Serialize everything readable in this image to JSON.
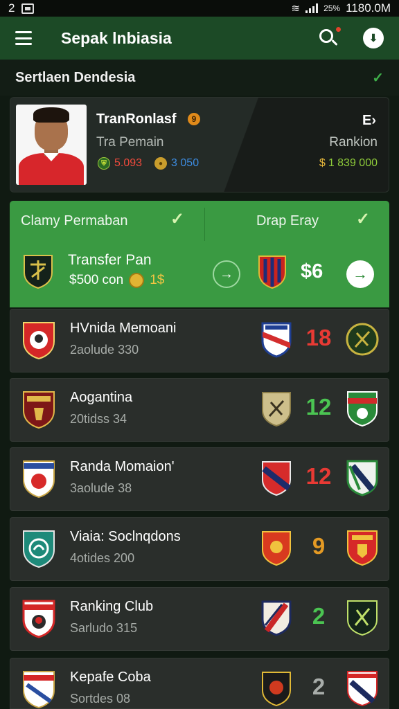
{
  "status_bar": {
    "left": "2",
    "battery_pct": "25%",
    "time": "1180.0M"
  },
  "app_bar": {
    "title": "Sepak lnbiasia"
  },
  "section": {
    "title": "Sertlaen Dendesia"
  },
  "profile_card": {
    "name": "TranRonlasf",
    "info_badge": "9",
    "subtitle": "Tra Pemain",
    "stat_a": "5.093",
    "stat_b": "3 050",
    "ranking_label": "Rankion",
    "ranking_value": "1 839 000",
    "next_arrow": "E›"
  },
  "transfer_panel": {
    "left_title": "Clamy Permaban",
    "right_title": "Drap Eray",
    "main_title": "Transfer Pan",
    "price": "$500 con",
    "price_coin": "1$",
    "value": "$6"
  },
  "clubs": [
    {
      "name": "HVnida Memoani",
      "sub": "2aolude 330",
      "rank": "18",
      "rank_color": "red"
    },
    {
      "name": "Aogantina",
      "sub": "20tidss 34",
      "rank": "12",
      "rank_color": "green"
    },
    {
      "name": "Randa Momaion'",
      "sub": "3aolude 38",
      "rank": "12",
      "rank_color": "red"
    },
    {
      "name": "Viaia: Soclnqdons",
      "sub": "4otides 200",
      "rank": "9",
      "rank_color": "orange"
    },
    {
      "name": "Ranking Club",
      "sub": "Sarludo 315",
      "rank": "2",
      "rank_color": "green"
    },
    {
      "name": "Kepafe Coba",
      "sub": "Sortdes 08",
      "rank": "2",
      "rank_color": "grey"
    }
  ],
  "icons": {
    "menu": "menu-icon",
    "search": "search-icon",
    "profile": "profile-icon",
    "check": "check-icon",
    "arrow": "arrow-right-icon"
  },
  "colors": {
    "app_bar": "#1c4a26",
    "transfer_panel": "#3a9a42",
    "row_bg": "#2a2e2b",
    "rank_red": "#e83a34",
    "rank_green": "#4bc452",
    "rank_orange": "#e49a24"
  }
}
